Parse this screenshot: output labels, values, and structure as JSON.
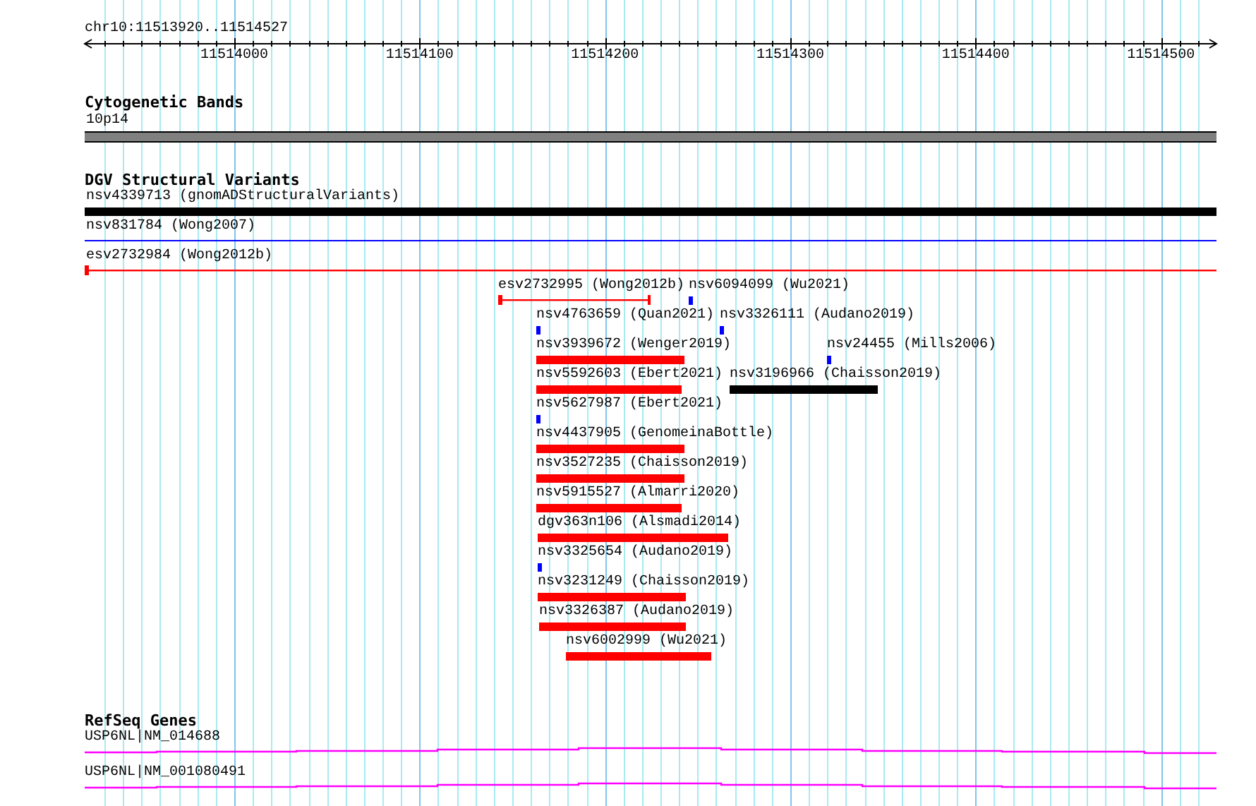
{
  "ruler": {
    "label": "chr10:11513920..11514527",
    "ticks": [
      "11514000",
      "11514100",
      "11514200",
      "11514300",
      "11514400",
      "11514500"
    ]
  },
  "cytogenetic_bands": {
    "title": "Cytogenetic Bands",
    "band": {
      "name": "10p14",
      "color": "#808080"
    }
  },
  "dgv_structural_variants": {
    "title": "DGV Structural Variants",
    "features": [
      {
        "label": "nsv4339713 (gnomADStructuralVariants)",
        "kind": "bar",
        "color": "#000000"
      },
      {
        "label": "nsv831784 (Wong2007)",
        "kind": "line",
        "color": "#0000ff"
      },
      {
        "label": "esv2732984 (Wong2012b)",
        "kind": "span",
        "color": "#ff0000"
      },
      {
        "label": "esv2732995 (Wong2012b)",
        "kind": "span",
        "color": "#ff0000"
      },
      {
        "label": "nsv6094099 (Wu2021)",
        "kind": "tick",
        "color": "#0000ff"
      },
      {
        "label": "nsv4763659 (Quan2021)",
        "kind": "tick",
        "color": "#0000ff"
      },
      {
        "label": "nsv3326111 (Audano2019)",
        "kind": "tick",
        "color": "#0000ff"
      },
      {
        "label": "nsv3939672 (Wenger2019)",
        "kind": "bar",
        "color": "#ff0000"
      },
      {
        "label": "nsv24455 (Mills2006)",
        "kind": "tick",
        "color": "#0000ff"
      },
      {
        "label": "nsv5592603 (Ebert2021)",
        "kind": "bar",
        "color": "#ff0000"
      },
      {
        "label": "nsv3196966 (Chaisson2019)",
        "kind": "bar",
        "color": "#000000"
      },
      {
        "label": "nsv5627987 (Ebert2021)",
        "kind": "tick",
        "color": "#0000ff"
      },
      {
        "label": "nsv4437905 (GenomeinaBottle)",
        "kind": "bar",
        "color": "#ff0000"
      },
      {
        "label": "nsv3527235 (Chaisson2019)",
        "kind": "bar",
        "color": "#ff0000"
      },
      {
        "label": "nsv5915527 (Almarri2020)",
        "kind": "bar",
        "color": "#ff0000"
      },
      {
        "label": "dgv363n106 (Alsmadi2014)",
        "kind": "bar",
        "color": "#ff0000"
      },
      {
        "label": "nsv3325654 (Audano2019)",
        "kind": "tick",
        "color": "#0000ff"
      },
      {
        "label": "nsv3231249 (Chaisson2019)",
        "kind": "bar",
        "color": "#ff0000"
      },
      {
        "label": "nsv3326387 (Audano2019)",
        "kind": "bar",
        "color": "#ff0000"
      },
      {
        "label": "nsv6002999 (Wu2021)",
        "kind": "bar",
        "color": "#ff0000"
      }
    ]
  },
  "refseq_genes": {
    "title": "RefSeq Genes",
    "genes": [
      {
        "label": "USP6NL|NM_014688",
        "color": "#ff00ff"
      },
      {
        "label": "USP6NL|NM_001080491",
        "color": "#ff00ff"
      }
    ]
  }
}
